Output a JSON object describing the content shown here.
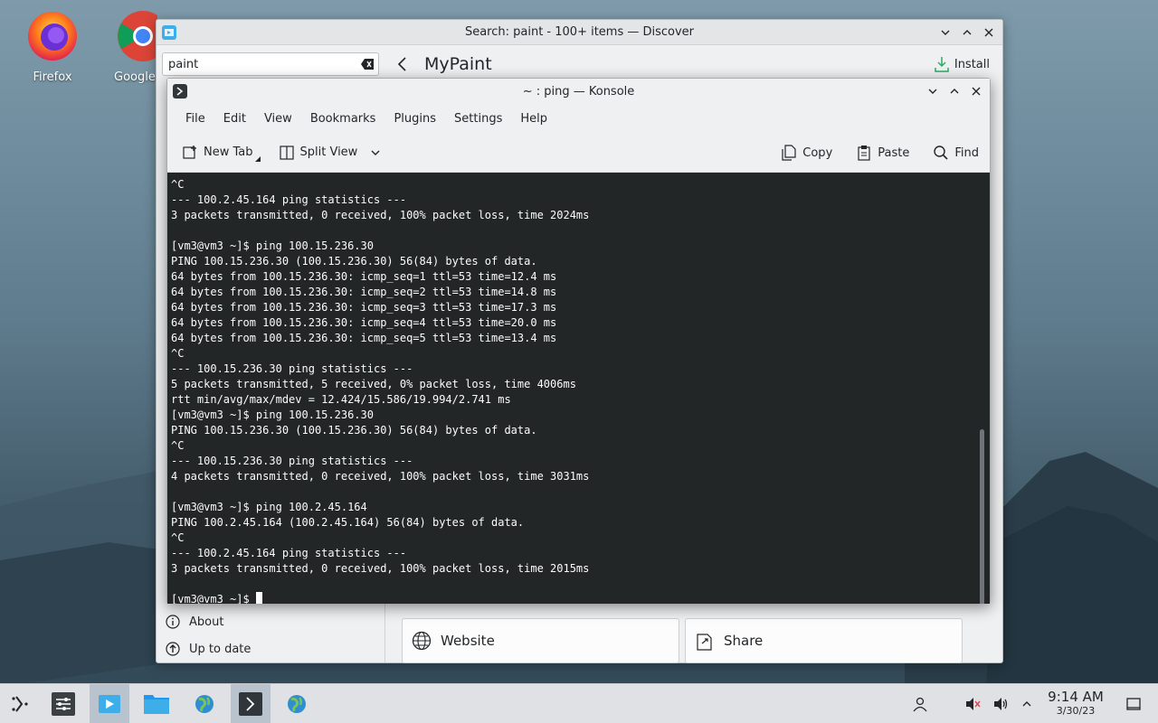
{
  "desktop": {
    "icons": [
      {
        "label": "Firefox",
        "icon": "firefox-icon"
      },
      {
        "label": "Google",
        "icon": "chrome-icon"
      }
    ]
  },
  "discover": {
    "title": "Search: paint - 100+ items — Discover",
    "search_value": "paint",
    "page_title": "MyPaint",
    "install_label": "Install",
    "sidebar": [
      {
        "label": "About",
        "icon": "info-icon"
      },
      {
        "label": "Up to date",
        "icon": "up-arrow-icon"
      }
    ],
    "cards": [
      {
        "label": "Website",
        "icon": "globe-icon"
      },
      {
        "label": "Share",
        "icon": "share-icon"
      }
    ]
  },
  "konsole": {
    "title": "~ : ping — Konsole",
    "menu": [
      "File",
      "Edit",
      "View",
      "Bookmarks",
      "Plugins",
      "Settings",
      "Help"
    ],
    "toolbar": {
      "new_tab": "New Tab",
      "split_view": "Split View",
      "copy": "Copy",
      "paste": "Paste",
      "find": "Find"
    },
    "lines": [
      "^C",
      "--- 100.2.45.164 ping statistics ---",
      "3 packets transmitted, 0 received, 100% packet loss, time 2024ms",
      "",
      "[vm3@vm3 ~]$ ping 100.15.236.30",
      "PING 100.15.236.30 (100.15.236.30) 56(84) bytes of data.",
      "64 bytes from 100.15.236.30: icmp_seq=1 ttl=53 time=12.4 ms",
      "64 bytes from 100.15.236.30: icmp_seq=2 ttl=53 time=14.8 ms",
      "64 bytes from 100.15.236.30: icmp_seq=3 ttl=53 time=17.3 ms",
      "64 bytes from 100.15.236.30: icmp_seq=4 ttl=53 time=20.0 ms",
      "64 bytes from 100.15.236.30: icmp_seq=5 ttl=53 time=13.4 ms",
      "^C",
      "--- 100.15.236.30 ping statistics ---",
      "5 packets transmitted, 5 received, 0% packet loss, time 4006ms",
      "rtt min/avg/max/mdev = 12.424/15.586/19.994/2.741 ms",
      "[vm3@vm3 ~]$ ping 100.15.236.30",
      "PING 100.15.236.30 (100.15.236.30) 56(84) bytes of data.",
      "^C",
      "--- 100.15.236.30 ping statistics ---",
      "4 packets transmitted, 0 received, 100% packet loss, time 3031ms",
      "",
      "[vm3@vm3 ~]$ ping 100.2.45.164",
      "PING 100.2.45.164 (100.2.45.164) 56(84) bytes of data.",
      "^C",
      "--- 100.2.45.164 ping statistics ---",
      "3 packets transmitted, 0 received, 100% packet loss, time 2015ms",
      ""
    ],
    "prompt": "[vm3@vm3 ~]$ "
  },
  "taskbar": {
    "time": "9:14 AM",
    "date": "3/30/23",
    "items": [
      "app-launcher-icon",
      "system-settings-icon",
      "discover-icon",
      "file-manager-icon",
      "firefox-globe-icon",
      "konsole-icon",
      "network-globe-icon"
    ],
    "tray": [
      "user-icon",
      "volume-muted-icon",
      "volume-icon",
      "chevron-up-icon",
      "show-desktop-icon"
    ]
  },
  "colors": {
    "terminal_bg": "#232627",
    "terminal_fg": "#fcfcfc",
    "accent": "#3daee9"
  }
}
